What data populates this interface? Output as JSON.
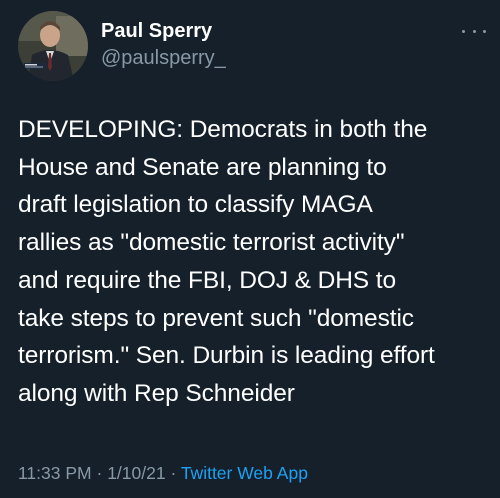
{
  "author": {
    "display_name": "Paul Sperry",
    "handle": "@paulsperry_"
  },
  "more_icon": "ellipsis-icon",
  "tweet": {
    "text": "DEVELOPING: Democrats in both the\nHouse and Senate are planning to\ndraft legislation to classify MAGA\nrallies as \"domestic terrorist activity\"\nand require the FBI, DOJ & DHS to\ntake steps to prevent such \"domestic\nterrorism.\" Sen. Durbin is leading effort\nalong with Rep Schneider",
    "time": "11:33 PM",
    "date": "1/10/21",
    "separator": "·",
    "source": "Twitter Web App"
  },
  "colors": {
    "background": "#15202b",
    "secondary_text": "#8899a6",
    "link": "#1da1f2"
  }
}
